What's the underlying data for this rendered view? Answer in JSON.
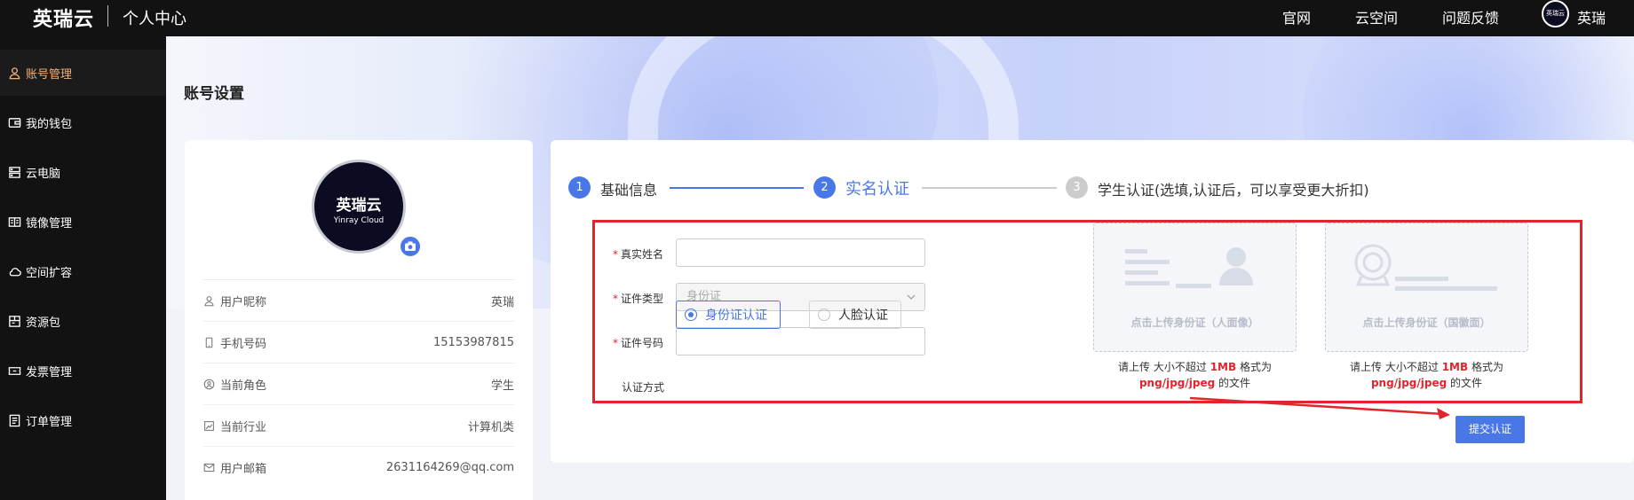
{
  "header": {
    "brand": "英瑞云",
    "section_title": "个人中心",
    "nav": [
      "官网",
      "云空间",
      "问题反馈"
    ],
    "avatar_text": "英瑞云",
    "username": "英瑞"
  },
  "sidebar": {
    "items": [
      {
        "label": "账号管理",
        "icon": "user-icon",
        "active": true
      },
      {
        "label": "我的钱包",
        "icon": "wallet-icon",
        "active": false
      },
      {
        "label": "云电脑",
        "icon": "server-icon",
        "active": false
      },
      {
        "label": "镜像管理",
        "icon": "book-icon",
        "active": false
      },
      {
        "label": "空间扩容",
        "icon": "cloud-icon",
        "active": false
      },
      {
        "label": "资源包",
        "icon": "package-icon",
        "active": false
      },
      {
        "label": "发票管理",
        "icon": "ticket-icon",
        "active": false
      },
      {
        "label": "订单管理",
        "icon": "document-icon",
        "active": false
      }
    ]
  },
  "page": {
    "title": "账号设置"
  },
  "profile": {
    "avatar_line1": "英瑞云",
    "avatar_line2": "Yinray Cloud",
    "rows": [
      {
        "label": "用户昵称",
        "value": "英瑞",
        "icon": "user-icon"
      },
      {
        "label": "手机号码",
        "value": "15153987815",
        "icon": "phone-icon"
      },
      {
        "label": "当前角色",
        "value": "学生",
        "icon": "role-icon"
      },
      {
        "label": "当前行业",
        "value": "计算机类",
        "icon": "industry-icon"
      },
      {
        "label": "用户邮箱",
        "value": "2631164269@qq.com",
        "icon": "mail-icon"
      }
    ]
  },
  "steps": [
    {
      "num": "1",
      "label": "基础信息",
      "status": "done"
    },
    {
      "num": "2",
      "label": "实名认证",
      "status": "active"
    },
    {
      "num": "3",
      "label": "学生认证(选填,认证后，可以享受更大折扣)",
      "status": "pending"
    }
  ],
  "form": {
    "real_name": {
      "label": "真实姓名",
      "value": ""
    },
    "id_type": {
      "label": "证件类型",
      "value": "身份证"
    },
    "id_number": {
      "label": "证件号码",
      "value": ""
    },
    "method": {
      "label": "认证方式",
      "options": [
        "身份证认证",
        "人脸认证"
      ],
      "selected": "身份证认证"
    }
  },
  "uploads": [
    {
      "caption": "点击上传身份证（人面像）",
      "hint_pre": "请上传 大小不超过 ",
      "hint_size": "1MB",
      "hint_mid": " 格式为",
      "hint_formats": "png/jpg/jpeg",
      "hint_post": " 的文件"
    },
    {
      "caption": "点击上传身份证（国徽面）",
      "hint_pre": "请上传 大小不超过 ",
      "hint_size": "1MB",
      "hint_mid": " 格式为",
      "hint_formats": "png/jpg/jpeg",
      "hint_post": " 的文件"
    }
  ],
  "submit_label": "提交认证",
  "colors": {
    "primary": "#4a77e8",
    "highlight": "#e0262d",
    "active_nav": "#f0b27a",
    "dark": "#121212"
  }
}
